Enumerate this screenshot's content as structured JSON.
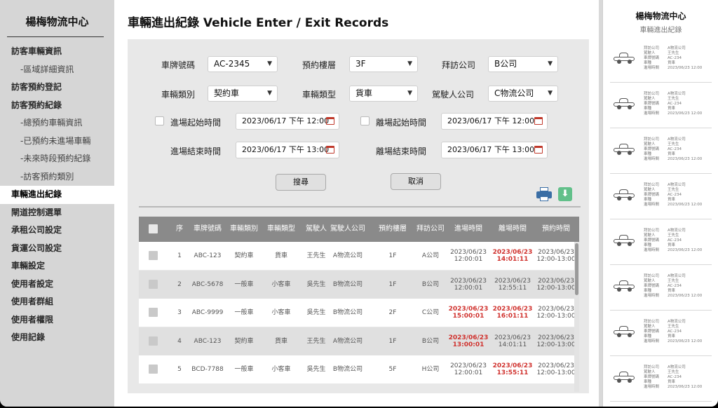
{
  "sidebar": {
    "title": "楊梅物流中心",
    "items": [
      {
        "label": "訪客車輛資訊",
        "sub": false,
        "active": false
      },
      {
        "label": "-區域詳細資訊",
        "sub": true,
        "active": false
      },
      {
        "label": "訪客預約登記",
        "sub": false,
        "active": false
      },
      {
        "label": "訪客預約紀錄",
        "sub": false,
        "active": false
      },
      {
        "label": "-總預約車輛資訊",
        "sub": true,
        "active": false
      },
      {
        "label": "-已預約未進場車輛",
        "sub": true,
        "active": false
      },
      {
        "label": "-未來時段預約紀錄",
        "sub": true,
        "active": false
      },
      {
        "label": "-訪客預約類別",
        "sub": true,
        "active": false
      },
      {
        "label": "車輛進出紀錄",
        "sub": false,
        "active": true
      },
      {
        "label": "閘道控制選單",
        "sub": false,
        "active": false
      },
      {
        "label": "承租公司設定",
        "sub": false,
        "active": false
      },
      {
        "label": "貨運公司設定",
        "sub": false,
        "active": false
      },
      {
        "label": "車輛設定",
        "sub": false,
        "active": false
      },
      {
        "label": "使用者設定",
        "sub": false,
        "active": false
      },
      {
        "label": "使用者群組",
        "sub": false,
        "active": false
      },
      {
        "label": "使用者權限",
        "sub": false,
        "active": false
      },
      {
        "label": "使用記錄",
        "sub": false,
        "active": false
      }
    ]
  },
  "header": {
    "title": "車輛進出紀錄    Vehicle Enter / Exit Records"
  },
  "filters": {
    "plate": {
      "label": "車牌號碼",
      "value": "AC-2345"
    },
    "floor": {
      "label": "預約樓層",
      "value": "3F"
    },
    "company": {
      "label": "拜訪公司",
      "value": "B公司"
    },
    "vehicle_class": {
      "label": "車輛類別",
      "value": "契約車"
    },
    "vehicle_type": {
      "label": "車輛類型",
      "value": "貨車"
    },
    "driver_company": {
      "label": "駕駛人公司",
      "value": "C物流公司"
    },
    "enter_start": {
      "label": "進場起始時間",
      "value": "2023/06/17 下午 12:00"
    },
    "exit_start": {
      "label": "離場起始時間",
      "value": "2023/06/17 下午 12:00"
    },
    "enter_end": {
      "label": "進場結束時間",
      "value": "2023/06/17 下午 13:00"
    },
    "exit_end": {
      "label": "離場結束時間",
      "value": "2023/06/17 下午 13:00"
    },
    "search_label": "搜尋",
    "cancel_label": "取消"
  },
  "table": {
    "columns": [
      "序",
      "車牌號碼",
      "車輛類別",
      "車輛類型",
      "駕駛人",
      "駕駛人公司",
      "預約樓層",
      "拜訪公司",
      "進場時間",
      "離場時間",
      "預約時間"
    ],
    "rows": [
      {
        "no": "1",
        "plate": "ABC-123",
        "class": "契約車",
        "type": "貨車",
        "driver": "王先生",
        "dcompany": "A物流公司",
        "floor": "1F",
        "company": "A公司",
        "enter": [
          "2023/06/23",
          "12:00:01"
        ],
        "enter_red": false,
        "exit": [
          "2023/06/23",
          "14:01:11"
        ],
        "exit_red": true,
        "booked": [
          "2023/06/23",
          "12:00-13:00"
        ]
      },
      {
        "no": "2",
        "plate": "ABC-5678",
        "class": "一般車",
        "type": "小客車",
        "driver": "吳先生",
        "dcompany": "B物流公司",
        "floor": "1F",
        "company": "B公司",
        "enter": [
          "2023/06/23",
          "12:00:01"
        ],
        "enter_red": false,
        "exit": [
          "2023/06/23",
          "12:55:11"
        ],
        "exit_red": false,
        "booked": [
          "2023/06/23",
          "12:00-13:00"
        ]
      },
      {
        "no": "3",
        "plate": "ABC-9999",
        "class": "一般車",
        "type": "小客車",
        "driver": "吳先生",
        "dcompany": "B物流公司",
        "floor": "2F",
        "company": "C公司",
        "enter": [
          "2023/06/23",
          "15:00:01"
        ],
        "enter_red": true,
        "exit": [
          "2023/06/23",
          "16:01:11"
        ],
        "exit_red": true,
        "booked": [
          "2023/06/23",
          "12:00-13:00"
        ]
      },
      {
        "no": "4",
        "plate": "ABC-123",
        "class": "契約車",
        "type": "貨車",
        "driver": "王先生",
        "dcompany": "A物流公司",
        "floor": "1F",
        "company": "B公司",
        "enter": [
          "2023/06/23",
          "13:00:01"
        ],
        "enter_red": true,
        "exit": [
          "2023/06/23",
          "14:01:11"
        ],
        "exit_red": false,
        "booked": [
          "2023/06/23",
          "12:00-13:00"
        ]
      },
      {
        "no": "5",
        "plate": "BCD-7788",
        "class": "一般車",
        "type": "小客車",
        "driver": "吳先生",
        "dcompany": "B物流公司",
        "floor": "5F",
        "company": "H公司",
        "enter": [
          "2023/06/23",
          "12:00:01"
        ],
        "enter_red": false,
        "exit": [
          "2023/06/23",
          "13:55:11"
        ],
        "exit_red": true,
        "booked": [
          "2023/06/23",
          "12:00-13:00"
        ]
      }
    ]
  },
  "preview": {
    "title": "楊梅物流中心",
    "subtitle": "車輛進出紀錄",
    "fields": [
      "拜訪公司",
      "駕駛人",
      "車牌號碼",
      "車種",
      "進場時間"
    ],
    "cards": [
      [
        "A物流公司",
        "王先生",
        "AC-234",
        "貨車",
        "2023/06/23 12:00"
      ],
      [
        "A物流公司",
        "王先生",
        "AC-234",
        "貨車",
        "2023/06/23 12:00"
      ],
      [
        "A物流公司",
        "王先生",
        "AC-234",
        "貨車",
        "2023/06/23 12:00"
      ],
      [
        "A物流公司",
        "王先生",
        "AC-234",
        "貨車",
        "2023/06/23 12:00"
      ],
      [
        "A物流公司",
        "王先生",
        "AC-234",
        "貨車",
        "2023/06/23 12:00"
      ],
      [
        "A物流公司",
        "王先生",
        "AC-234",
        "貨車",
        "2023/06/23 12:00"
      ],
      [
        "A物流公司",
        "王先生",
        "AC-234",
        "貨車",
        "2023/06/23 12:00"
      ],
      [
        "A物流公司",
        "王先生",
        "AC-234",
        "貨車",
        "2023/06/23 12:00"
      ]
    ]
  }
}
